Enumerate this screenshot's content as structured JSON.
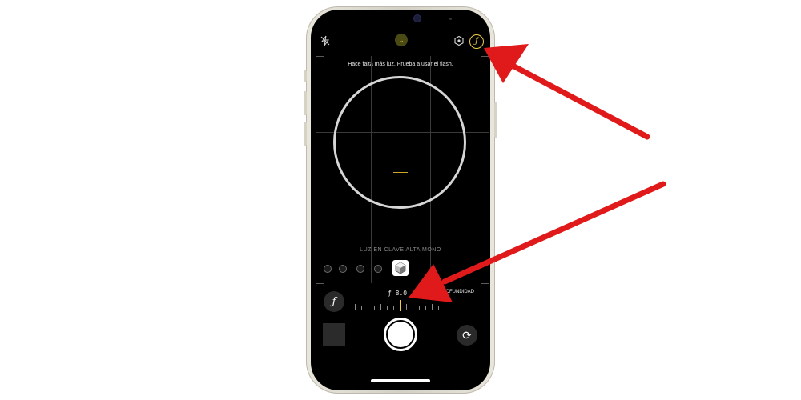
{
  "camera": {
    "hint_text": "Hace falta más luz. Prueba a usar el flash.",
    "mode_label": "LUZ EN CLAVE ALTA MONO",
    "aperture_value": "ƒ 8.0",
    "depth_label": "PROFUNDIDAD",
    "aperture_button_glyph": "ƒ",
    "flip_glyph": "⟳",
    "chevron_glyph": "⌄"
  },
  "icons": [
    "flash-off-icon",
    "chevron-down-icon",
    "live-photo-icon",
    "aperture-icon",
    "switch-camera-icon"
  ],
  "colors": {
    "accent_yellow": "#f2d046",
    "annotation_red": "#e01a1a",
    "screen_black": "#000000",
    "frame": "#e3e0d6"
  }
}
